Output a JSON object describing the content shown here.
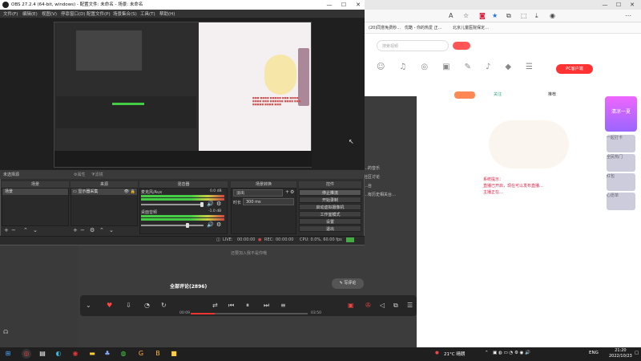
{
  "obs": {
    "title": "OBS 27.2.4 (64-bit, windows) - 配置文件: 未命名 - 场景: 未命名",
    "menu": [
      "文件(F)",
      "编辑(E)",
      "视图(V)",
      "停靠窗口(D)",
      "配置文件(P)",
      "场景集合(S)",
      "工具(T)",
      "帮助(H)"
    ],
    "no_source": "未选择源",
    "props": "属性",
    "filters": "滤镜",
    "docks": {
      "scenes": {
        "title": "场景",
        "item": "场景"
      },
      "sources": {
        "title": "来源",
        "item": "显示器采集"
      },
      "mixer": {
        "title": "混音器",
        "ch1": {
          "name": "麦克风/Aux",
          "db": "0.0 dB"
        },
        "ch2": {
          "name": "桌面音频",
          "db": "-1.0 dB"
        }
      },
      "transitions": {
        "title": "场景转换",
        "type": "淡出",
        "duration_label": "时长",
        "duration": "300 ms"
      },
      "controls": {
        "title": "控件",
        "buttons": [
          "停止推流",
          "开始录制",
          "启动虚拟摄像机",
          "工作室模式",
          "设置",
          "退出"
        ]
      }
    },
    "status": {
      "live_label": "LIVE:",
      "live_time": "00:00:00",
      "rec_label": "REC:",
      "rec_time": "00:00:00",
      "cpu": "CPU: 0.0%, 60.00 fps"
    }
  },
  "browser": {
    "favorites": [
      "(20)同意免费秒…",
      "优酷 - 你的热爱 正…",
      "北京儿童医院保定…"
    ],
    "search_placeholder": "搜索视频",
    "pc_button": "PC客户端",
    "right_tabs": [
      "关注",
      "推荐",
      "红包"
    ],
    "notice_lines": [
      "系统提示：",
      "直播已开启，现在可以发布直播…",
      "主播正在…"
    ],
    "side_sticker": "清凉一夏",
    "side_cards": [
      "一起打卡",
      "全民热门",
      "红包",
      "心愿单"
    ]
  },
  "player": {
    "all_comments": "全部评论(2896)",
    "write_comment": "写评论",
    "time_current": "00:09",
    "time_total": "03:50",
    "empty_hint": "还要加入我不是你哦",
    "mid_lines": [
      "…的音乐",
      "社区讨论",
      "…台",
      "…有历史相关台…"
    ]
  },
  "taskbar": {
    "weather": "21°C 晴朗",
    "lang": "ENG",
    "time": "21:20",
    "date": "2022/10/23"
  }
}
